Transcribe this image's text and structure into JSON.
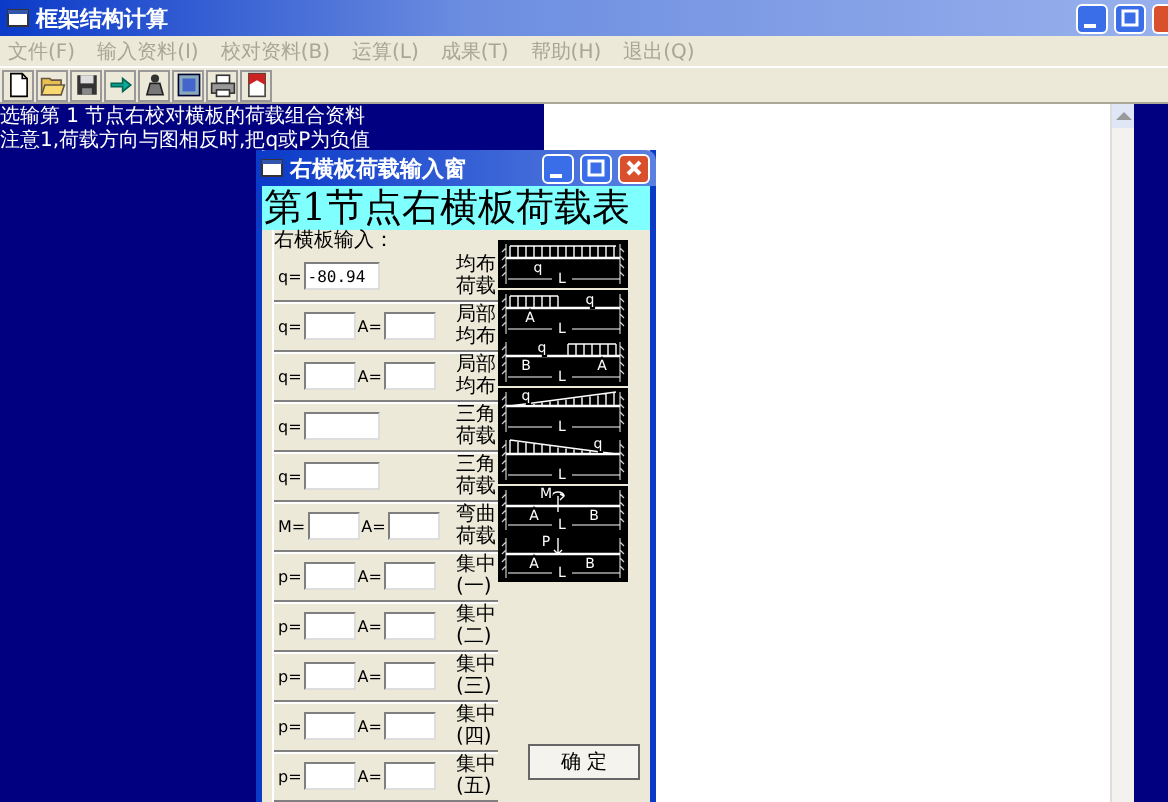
{
  "window": {
    "title": "框架结构计算"
  },
  "menu": [
    {
      "label": "文件(F)",
      "disabled": true
    },
    {
      "label": "输入资料(I)",
      "disabled": true
    },
    {
      "label": "校对资料(B)",
      "disabled": true
    },
    {
      "label": "运算(L)",
      "disabled": true
    },
    {
      "label": "成果(T)",
      "disabled": true
    },
    {
      "label": "帮助(H)",
      "disabled": true
    },
    {
      "label": "退出(Q)",
      "disabled": true
    }
  ],
  "toolbar": [
    {
      "kind": "new"
    },
    {
      "kind": "open"
    },
    {
      "kind": "save"
    },
    {
      "kind": "arrow"
    },
    {
      "kind": "figure"
    },
    {
      "kind": "frame"
    },
    {
      "kind": "print"
    },
    {
      "kind": "book"
    }
  ],
  "console": {
    "lines": [
      " 选输第 1 节点右校对横板的荷载组合资料",
      "注意1,荷载方向与图相反时,把q或P为负值"
    ]
  },
  "dialog": {
    "title": "右横板荷载输入窗",
    "heading": "第1节点右横板荷载表",
    "group_label": "右横板输入：",
    "button": "确  定",
    "rows": [
      {
        "fields": [
          {
            "label": "q=",
            "value": "-80.94"
          }
        ],
        "caption": [
          "均布",
          "荷载"
        ],
        "diagram": {
          "kind": "uniform",
          "labels": [
            "q",
            "L"
          ]
        }
      },
      {
        "fields": [
          {
            "label": "q="
          },
          {
            "label": "A="
          }
        ],
        "caption": [
          "局部",
          "均布"
        ],
        "diagram": {
          "kind": "partial_left",
          "labels": [
            "q",
            "A",
            "L"
          ]
        }
      },
      {
        "fields": [
          {
            "label": "q="
          },
          {
            "label": "A="
          }
        ],
        "caption": [
          "局部",
          "均布"
        ],
        "diagram": {
          "kind": "partial_right",
          "labels": [
            "q",
            "B",
            "L",
            "A"
          ]
        }
      },
      {
        "fields": [
          {
            "label": "q="
          }
        ],
        "caption": [
          "三角",
          "荷载"
        ],
        "diagram": {
          "kind": "tri_up",
          "labels": [
            "q",
            "L"
          ]
        }
      },
      {
        "fields": [
          {
            "label": "q="
          }
        ],
        "caption": [
          "三角",
          "荷载"
        ],
        "diagram": {
          "kind": "tri_down",
          "labels": [
            "q",
            "L"
          ]
        }
      },
      {
        "fields": [
          {
            "label": "M="
          },
          {
            "label": "A="
          }
        ],
        "caption": [
          "弯曲",
          "荷载"
        ],
        "diagram": {
          "kind": "moment",
          "labels": [
            "M",
            "A",
            "B",
            "L"
          ]
        }
      },
      {
        "fields": [
          {
            "label": "p="
          },
          {
            "label": "A="
          }
        ],
        "caption": [
          "集中",
          "(一)"
        ],
        "diagram": {
          "kind": "point",
          "labels": [
            "P",
            "A",
            "B",
            "L"
          ]
        }
      },
      {
        "fields": [
          {
            "label": "p="
          },
          {
            "label": "A="
          }
        ],
        "caption": [
          "集中",
          "(二)"
        ]
      },
      {
        "fields": [
          {
            "label": "p="
          },
          {
            "label": "A="
          }
        ],
        "caption": [
          "集中",
          "(三)"
        ]
      },
      {
        "fields": [
          {
            "label": "p="
          },
          {
            "label": "A="
          }
        ],
        "caption": [
          "集中",
          "(四)"
        ]
      },
      {
        "fields": [
          {
            "label": "p="
          },
          {
            "label": "A="
          }
        ],
        "caption": [
          "集中",
          "(五)"
        ]
      }
    ]
  }
}
